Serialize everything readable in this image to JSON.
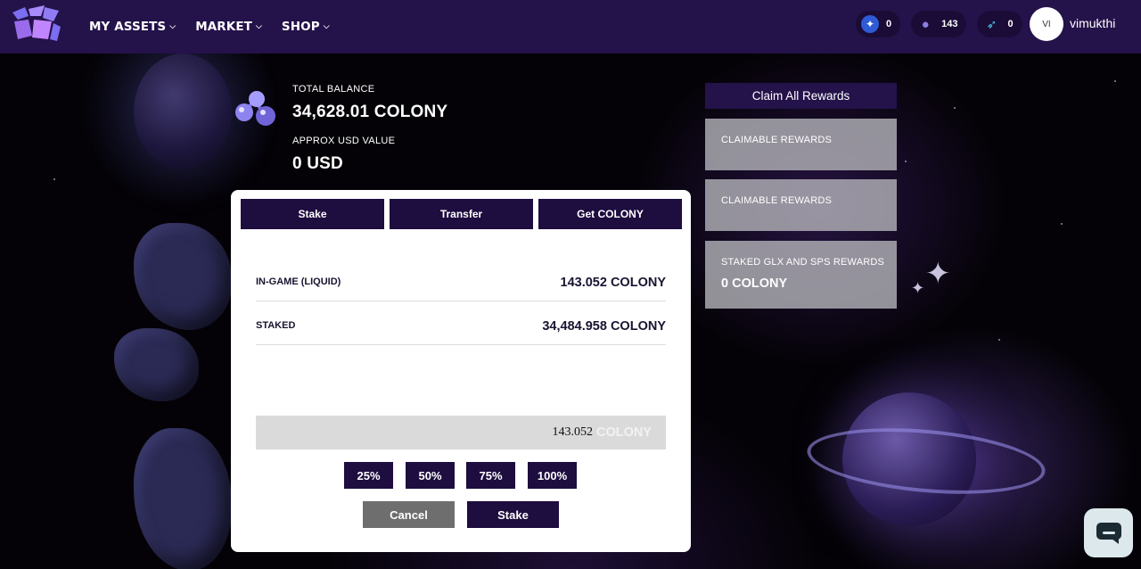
{
  "nav": {
    "menu": [
      {
        "label": "MY ASSETS",
        "icon": "chevron-down-icon"
      },
      {
        "label": "MARKET",
        "icon": "chevron-down-icon"
      },
      {
        "label": "SHOP",
        "icon": "chevron-down-icon"
      }
    ],
    "counters": [
      {
        "icon": "star-token-icon",
        "value": "0",
        "color": "#2e5bd6"
      },
      {
        "icon": "colony-token-icon",
        "value": "143",
        "color": "#8a7ee0"
      },
      {
        "icon": "rocket-icon",
        "value": "0",
        "color": "#4fc3e8"
      }
    ],
    "user": {
      "initials": "VI",
      "name": "vimukthi"
    }
  },
  "balance": {
    "total_label": "TOTAL BALANCE",
    "total_value": "34,628.01 COLONY",
    "usd_label": "APPROX USD VALUE",
    "usd_value": "0 USD"
  },
  "card": {
    "tabs": [
      "Stake",
      "Transfer",
      "Get COLONY"
    ],
    "rows": [
      {
        "label": "IN-GAME (LIQUID)",
        "value": "143.052 COLONY"
      },
      {
        "label": "STAKED",
        "value": "34,484.958 COLONY"
      }
    ],
    "amount": {
      "value": "143.052",
      "unit": "COLONY"
    },
    "percent_buttons": [
      "25%",
      "50%",
      "75%",
      "100%"
    ],
    "cancel_label": "Cancel",
    "stake_label": "Stake"
  },
  "rewards": {
    "claim_all_label": "Claim All Rewards",
    "cards": [
      {
        "title": "CLAIMABLE REWARDS",
        "value": ""
      },
      {
        "title": "CLAIMABLE REWARDS",
        "value": ""
      },
      {
        "title": "STAKED GLX AND SPS REWARDS",
        "value": "0 COLONY"
      }
    ]
  },
  "colors": {
    "nav_bg": "#24124a",
    "button_dark": "#1e0d3f",
    "cancel_grey": "#6e6e6e"
  }
}
